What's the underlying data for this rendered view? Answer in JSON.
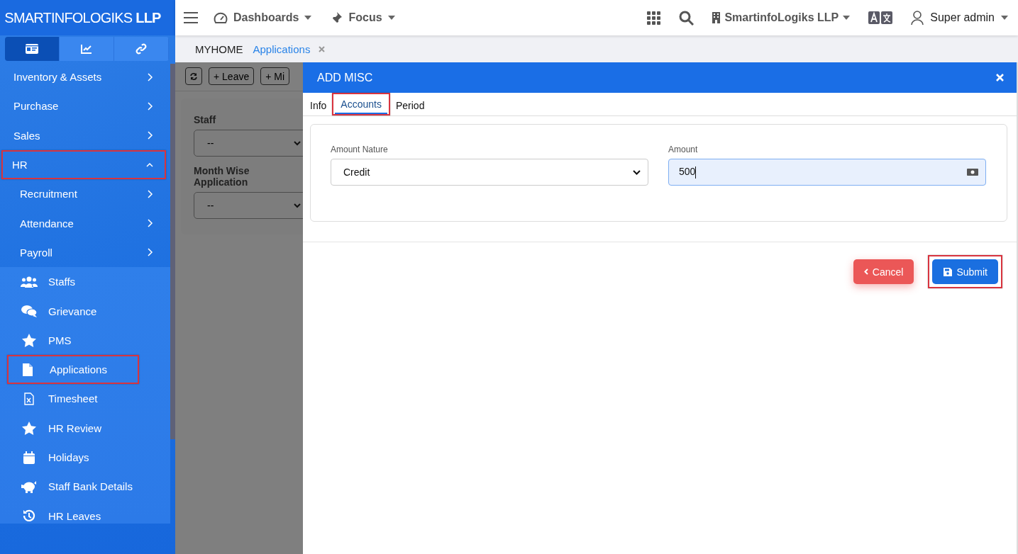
{
  "brand": {
    "name": "SMARTINFOLOGIKS",
    "suffix": "LLP"
  },
  "sidebar": {
    "view_tabs": [
      {
        "selected": true
      },
      {
        "selected": false
      },
      {
        "selected": false
      }
    ],
    "items": [
      {
        "label": "Inventory & Assets",
        "expanded": false,
        "highlighted": false
      },
      {
        "label": "Purchase",
        "expanded": false,
        "highlighted": false
      },
      {
        "label": "Sales",
        "expanded": false,
        "highlighted": false
      },
      {
        "label": "HR",
        "expanded": true,
        "highlighted": true,
        "children": [
          {
            "label": "Recruitment",
            "kind": "group",
            "highlighted": false
          },
          {
            "label": "Attendance",
            "kind": "group",
            "highlighted": false
          },
          {
            "label": "Payroll",
            "kind": "group",
            "highlighted": false
          },
          {
            "label": "Staffs",
            "kind": "link",
            "highlighted": false
          },
          {
            "label": "Grievance",
            "kind": "link",
            "highlighted": false
          },
          {
            "label": "PMS",
            "kind": "link",
            "highlighted": false
          },
          {
            "label": "Applications",
            "kind": "link",
            "highlighted": true
          },
          {
            "label": "Timesheet",
            "kind": "link",
            "highlighted": false
          },
          {
            "label": "HR Review",
            "kind": "link",
            "highlighted": false
          },
          {
            "label": "Holidays",
            "kind": "link",
            "highlighted": false
          },
          {
            "label": "Staff Bank Details",
            "kind": "link",
            "highlighted": false
          },
          {
            "label": "HR Leaves",
            "kind": "link",
            "highlighted": false
          }
        ]
      }
    ]
  },
  "topbar": {
    "menus": [
      "Dashboards",
      "Focus"
    ],
    "company": "SmartinfoLogiks LLP",
    "user": "Super admin"
  },
  "page_tabs": [
    {
      "label": "MYHOME",
      "selected": false,
      "closable": false
    },
    {
      "label": "Applications",
      "selected": true,
      "closable": true
    }
  ],
  "page": {
    "toolbar": [
      "+ Leave",
      "+ Mi"
    ],
    "filters": [
      {
        "label": "Staff",
        "value": "--"
      },
      {
        "label": "Month Wise Application",
        "value": "--"
      }
    ]
  },
  "modal": {
    "title": "ADD MISC",
    "tabs": [
      {
        "label": "Info",
        "selected": false,
        "highlighted": false
      },
      {
        "label": "Accounts",
        "selected": true,
        "highlighted": true
      },
      {
        "label": "Period",
        "selected": false,
        "highlighted": false
      }
    ],
    "fields": [
      {
        "kind": "select",
        "label": "Amount Nature",
        "value": "Credit",
        "focused": false
      },
      {
        "kind": "input",
        "label": "Amount",
        "value": "500",
        "focused": true
      }
    ],
    "buttons": [
      {
        "kind": "cancel",
        "label": "Cancel",
        "highlighted": false
      },
      {
        "kind": "submit",
        "label": "Submit",
        "highlighted": true
      }
    ]
  }
}
